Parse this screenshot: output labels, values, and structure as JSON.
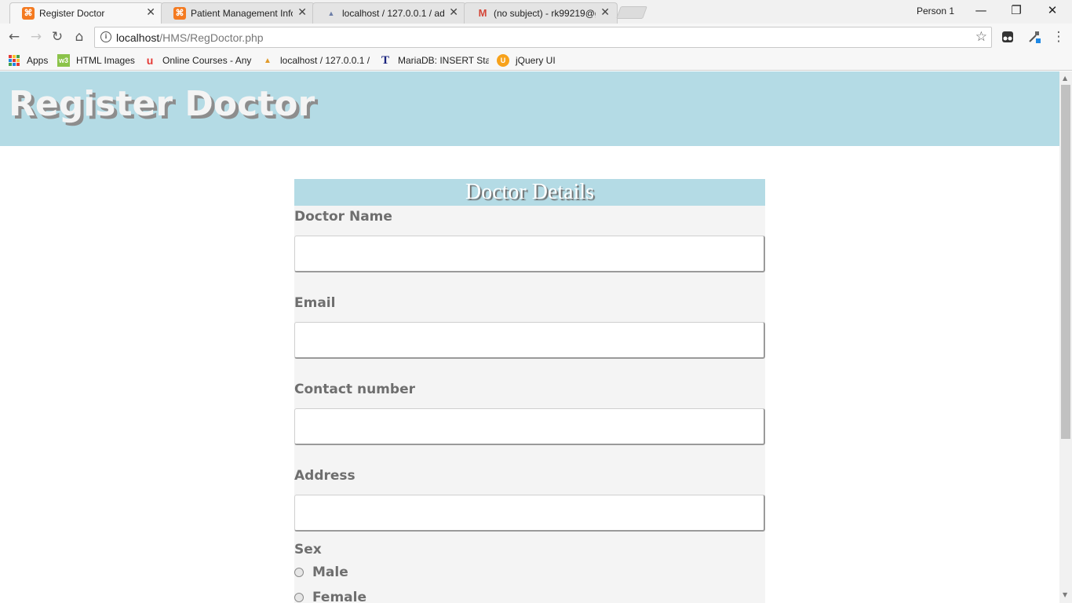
{
  "browser": {
    "tabs": [
      {
        "title": "Register Doctor",
        "icon": "xampp-icon"
      },
      {
        "title": "Patient Management Info",
        "icon": "xampp-icon"
      },
      {
        "title": "localhost / 127.0.0.1 / adm",
        "icon": "phpmyadmin-icon"
      },
      {
        "title": "(no subject) - rk99219@g",
        "icon": "gmail-icon"
      }
    ],
    "profile": "Person 1",
    "url_host": "localhost",
    "url_path": "/HMS/RegDoctor.php",
    "bookmarks": [
      {
        "label": "Apps",
        "icon": "apps-grid-icon"
      },
      {
        "label": "HTML Images",
        "icon": "w3schools-icon"
      },
      {
        "label": "Online Courses - Any",
        "icon": "udemy-icon"
      },
      {
        "label": "localhost / 127.0.0.1 /",
        "icon": "phpmyadmin-icon"
      },
      {
        "label": "MariaDB: INSERT Stat",
        "icon": "mariadb-icon"
      },
      {
        "label": "jQuery UI",
        "icon": "jquery-ui-icon"
      }
    ]
  },
  "page": {
    "header_title": "Register Doctor",
    "form_title": "Doctor Details",
    "fields": [
      {
        "label": "Doctor Name",
        "value": ""
      },
      {
        "label": "Email",
        "value": ""
      },
      {
        "label": "Contact number",
        "value": ""
      },
      {
        "label": "Address",
        "value": ""
      }
    ],
    "sex_label": "Sex",
    "sex_options": [
      "Male",
      "Female"
    ]
  },
  "colors": {
    "header_bg": "#b4dbe5",
    "form_bg": "#f4f4f4",
    "label_text": "#6e6e6e"
  }
}
